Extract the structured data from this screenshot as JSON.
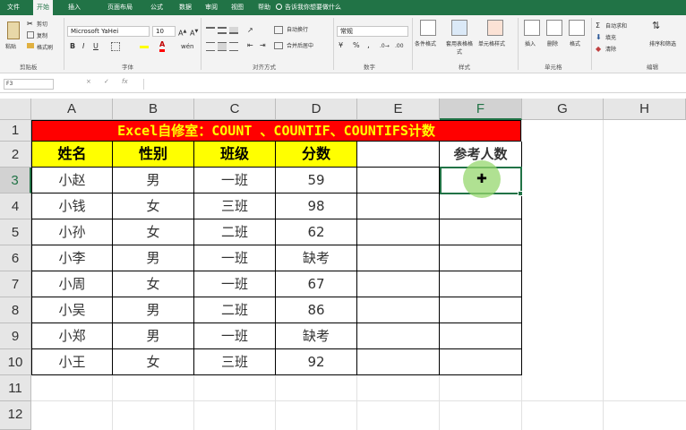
{
  "tabs": [
    "文件",
    "开始",
    "插入",
    "页面布局",
    "公式",
    "数据",
    "审阅",
    "视图",
    "帮助"
  ],
  "active_tab": "开始",
  "tell_me": "告诉我你想要做什么",
  "ribbon": {
    "paste": "粘贴",
    "cut": "剪切",
    "copy": "复制",
    "format_painter": "格式刷",
    "font_name": "Microsoft YaHei",
    "font_size": "10",
    "wrap_text": "自动换行",
    "merge_center": "合并后居中",
    "number_format": "常规",
    "conditional_format": "条件格式",
    "format_as_table": "套用表格格式",
    "cell_styles": "单元格样式",
    "insert": "插入",
    "delete": "删除",
    "format": "格式",
    "autosum": "自动求和",
    "fill": "填充",
    "clear": "清除",
    "sort_filter": "排序和筛选",
    "groups": [
      "剪贴板",
      "字体",
      "对齐方式",
      "数字",
      "样式",
      "单元格",
      "编辑"
    ]
  },
  "name_box": "F3",
  "formula_icons": [
    "×",
    "✓",
    "fx"
  ],
  "sheet": {
    "columns": [
      "A",
      "B",
      "C",
      "D",
      "E",
      "F",
      "G",
      "H"
    ],
    "selected_column": "F",
    "rows": [
      "1",
      "2",
      "3",
      "4",
      "5",
      "6",
      "7",
      "8",
      "9",
      "10",
      "11",
      "12"
    ],
    "selected_row": "3",
    "title": "Excel自修室：COUNT 、COUNTIF、COUNTIFS计数",
    "headers": [
      "姓名",
      "性别",
      "班级",
      "分数"
    ],
    "f_header": "参考人数",
    "data": [
      [
        "小赵",
        "男",
        "一班",
        "59"
      ],
      [
        "小钱",
        "女",
        "三班",
        "98"
      ],
      [
        "小孙",
        "女",
        "二班",
        "62"
      ],
      [
        "小李",
        "男",
        "一班",
        "缺考"
      ],
      [
        "小周",
        "女",
        "一班",
        "67"
      ],
      [
        "小吴",
        "男",
        "二班",
        "86"
      ],
      [
        "小郑",
        "男",
        "一班",
        "缺考"
      ],
      [
        "小王",
        "女",
        "三班",
        "92"
      ]
    ]
  },
  "colors": {
    "accent": "#217346",
    "title_bg": "#ff0000",
    "title_text": "#ffff00",
    "header_bg": "#ffff00"
  }
}
